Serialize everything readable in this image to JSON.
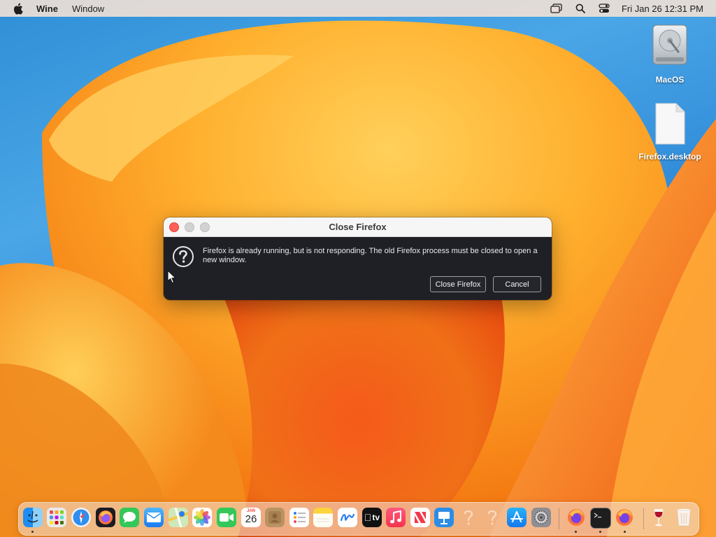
{
  "menubar": {
    "app_name": "Wine",
    "menus": [
      "Window"
    ],
    "clock": "Fri Jan 26  12:31 PM"
  },
  "desktop": {
    "icons": [
      {
        "label": "MacOS",
        "icon": "hard-drive-icon"
      },
      {
        "label": "Firefox.desktop",
        "icon": "document-icon"
      }
    ]
  },
  "dialog": {
    "title": "Close Firefox",
    "message": "Firefox is already running, but is not responding. The old Firefox process must be closed to open a new window.",
    "buttons": {
      "close": "Close Firefox",
      "cancel": "Cancel"
    },
    "icon": "question-icon"
  },
  "dock": {
    "calendar_month": "JAN",
    "calendar_day": "26",
    "tv_label": "tv",
    "apps": [
      "finder",
      "launchpad",
      "safari",
      "firefox",
      "messages",
      "mail",
      "maps",
      "photos",
      "facetime",
      "calendar",
      "contacts",
      "reminders",
      "notes",
      "freeform",
      "tv",
      "music",
      "news",
      "keynote",
      "help",
      "help",
      "app-store",
      "system-settings",
      "firefox",
      "terminal",
      "firefox",
      "wine",
      "trash"
    ]
  },
  "colors": {
    "dialog_bg": "#1f2026",
    "titlebar_bg": "#f6f6f6",
    "close_light": "#fe5f57"
  }
}
